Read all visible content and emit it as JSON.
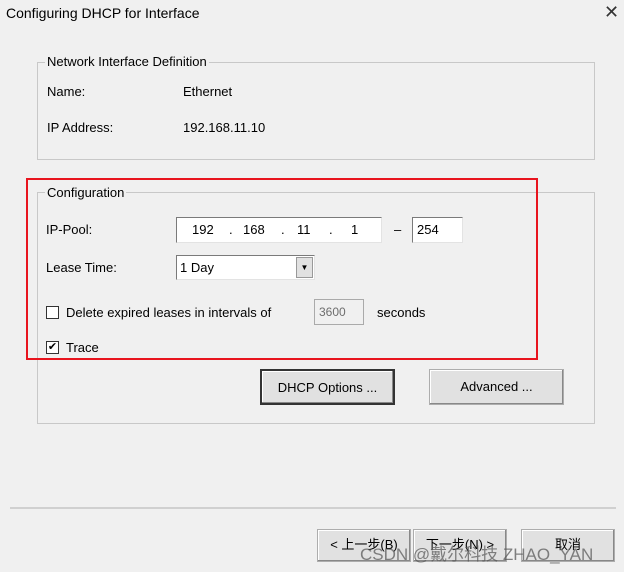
{
  "window": {
    "title": "Configuring DHCP for Interface",
    "close_icon": "close-icon"
  },
  "interface_group": {
    "legend": "Network Interface Definition",
    "name_label": "Name:",
    "name_value": "Ethernet",
    "ip_label": "IP Address:",
    "ip_value": "192.168.11.10"
  },
  "config_group": {
    "legend": "Configuration",
    "ip_pool_label": "IP-Pool:",
    "ip_pool_start": [
      "192",
      "168",
      "11",
      "1"
    ],
    "ip_pool_dash": "–",
    "ip_pool_end": "254",
    "lease_label": "Lease Time:",
    "lease_value": "1 Day",
    "delete_label": "Delete expired leases in intervals of",
    "delete_checked": false,
    "interval_value": "3600",
    "seconds_label": "seconds",
    "trace_label": "Trace",
    "trace_checked": true,
    "dhcp_options_button": "DHCP Options ...",
    "advanced_button": "Advanced ..."
  },
  "footer": {
    "back_button": "< 上一步(B)",
    "next_button": "下一步(N) >",
    "cancel_button": "取消"
  },
  "watermark": "CSDN @戴尔科技 ZHAO_YAN",
  "colors": {
    "highlight": "#e8141e"
  }
}
